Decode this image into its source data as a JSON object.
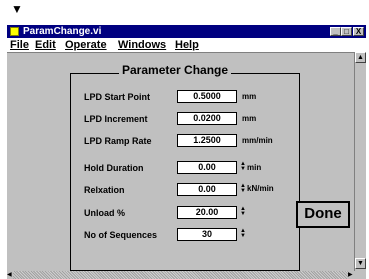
{
  "window": {
    "title": "ParamChange.vi",
    "minimize": "_",
    "maximize": "□",
    "close": "X"
  },
  "menu": [
    {
      "label": "File",
      "key": "F"
    },
    {
      "label": "Edit",
      "key": "E"
    },
    {
      "label": "Operate",
      "key": "O"
    },
    {
      "label": "Windows",
      "key": "W"
    },
    {
      "label": "Help",
      "key": "H"
    }
  ],
  "indicator_arrow": "▼",
  "panel": {
    "group_title": "Parameter Change",
    "rows": [
      {
        "label": "LPD Start Point",
        "value": "0.5000",
        "unit": "mm"
      },
      {
        "label": "LPD Increment",
        "value": "0.0200",
        "unit": "mm"
      },
      {
        "label": "LPD Ramp Rate",
        "value": "1.2500",
        "unit": "mm/min"
      },
      {
        "label": "Hold Duration",
        "value": "0.00",
        "unit": "min"
      },
      {
        "label": "Relxation",
        "value": "0.00",
        "unit": "kN/min"
      },
      {
        "label": "Unload  %",
        "value": "20.00",
        "unit": ""
      },
      {
        "label": "No of Sequences",
        "value": "30",
        "unit": ""
      }
    ],
    "done_label": "Done"
  }
}
